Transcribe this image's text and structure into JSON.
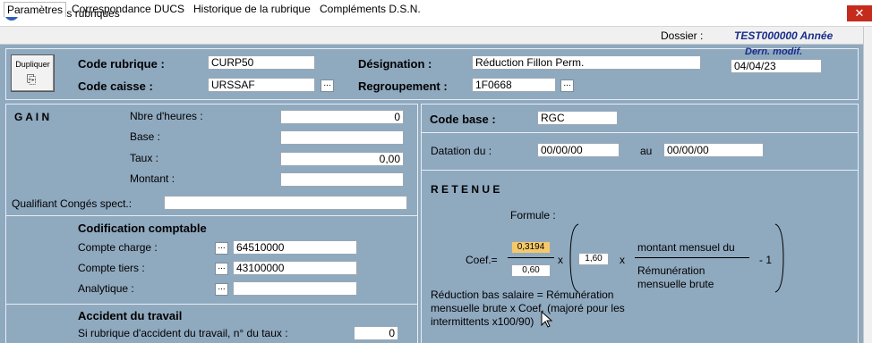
{
  "window": {
    "app_icon": "4D",
    "title": "Saisie des rubriques",
    "close_glyph": "✕"
  },
  "tabs": [
    "Paramètres",
    "Correspondance DUCS",
    "Historique de la rubrique",
    "Compléments D.S.N."
  ],
  "dossier": {
    "label": "Dossier :",
    "value": "TEST000000 Année"
  },
  "header": {
    "duplicate_label": "Dupliquer",
    "code_rubrique_label": "Code rubrique :",
    "code_rubrique_value": "CURP50",
    "code_caisse_label": "Code caisse :",
    "code_caisse_value": "URSSAF",
    "designation_label": "Désignation :",
    "designation_value": "Réduction Fillon Perm.",
    "regroupement_label": "Regroupement :",
    "regroupement_value": "1F0668",
    "dern_modif_label": "Dern. modif.",
    "dern_modif_value": "04/04/23",
    "dots": "..."
  },
  "gain": {
    "title": "G A I N",
    "nbre_heures_label": "Nbre d'heures :",
    "nbre_heures_value": "0",
    "base_label": "Base :",
    "base_value": "",
    "taux_label": "Taux :",
    "taux_value": "0,00",
    "montant_label": "Montant :",
    "montant_value": "",
    "qualifiant_label": "Qualifiant Congés spect.:",
    "qualifiant_value": ""
  },
  "codification": {
    "title": "Codification comptable",
    "compte_charge_label": "Compte charge :",
    "compte_charge_value": "64510000",
    "compte_tiers_label": "Compte tiers :",
    "compte_tiers_value": "43100000",
    "analytique_label": "Analytique :",
    "analytique_value": ""
  },
  "accident": {
    "title": "Accident du travail",
    "question": "Si rubrique d'accident du travail, n° du taux :",
    "value": "0"
  },
  "right": {
    "code_base_label": "Code base :",
    "code_base_value": "RGC",
    "datation_label": "Datation du :",
    "datation_from": "00/00/00",
    "au_label": "au",
    "datation_to": "00/00/00"
  },
  "retenue": {
    "title": "R E T E N U E",
    "formule_label": "Formule :",
    "coef_label": "Coef.=",
    "numerator": "0,3194",
    "denominator": "0,60",
    "times1": "x",
    "multiplier": "1,60",
    "times2": "x",
    "frac_top": "montant mensuel du",
    "frac_bottom_1": "Rémunération",
    "frac_bottom_2": "mensuelle brute",
    "minus_one": "- 1",
    "note_1": "Réduction bas salaire = Rémunération",
    "note_2": "mensuelle brute x Coef. (majoré pour les",
    "note_3": "intermittents x100/90)"
  },
  "colors": {
    "background": "#8fa9bf",
    "highlight": "#f5c96a",
    "title_blue": "#1a2d8a",
    "close_red": "#c42b1c"
  }
}
